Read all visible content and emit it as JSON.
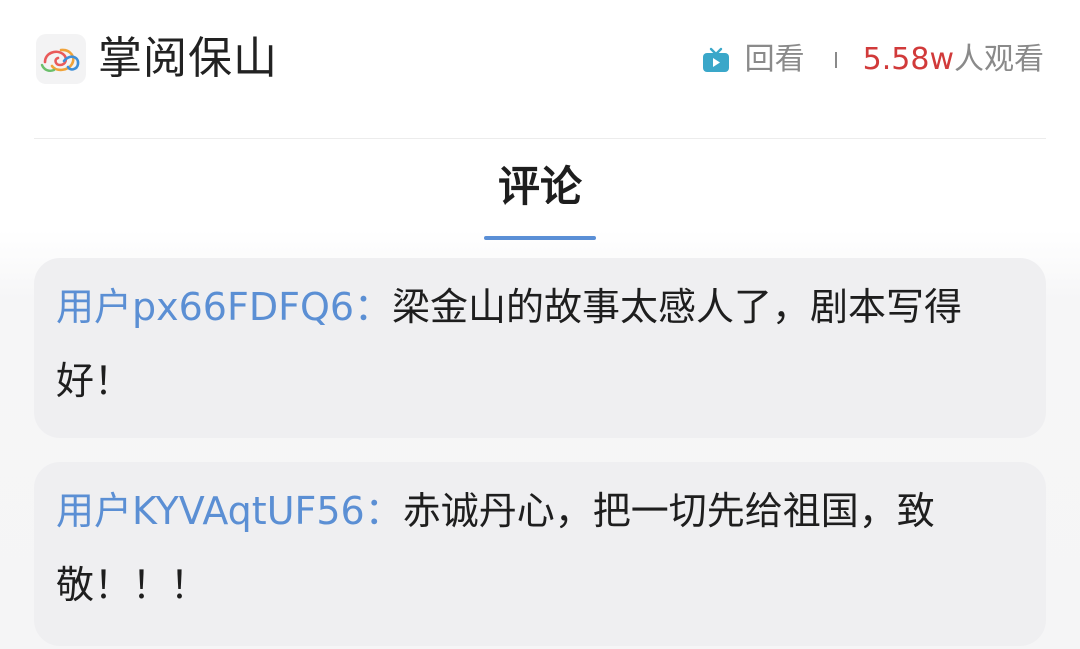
{
  "header": {
    "app_title": "掌阅保山",
    "replay_label": "回看",
    "views_count": "5.58w",
    "views_suffix": "人观看",
    "colors": {
      "title": "#222222",
      "meta": "#8a8a8a",
      "views_count": "#d13a3a",
      "tv_icon": "#3aa7c9"
    }
  },
  "tabs": {
    "active_label": "评论",
    "accent": "#5a8fd6"
  },
  "comments": [
    {
      "user": "用户px66FDFQ6：",
      "text": "梁金山的故事太感人了，剧本写得好！"
    },
    {
      "user": "用户KYVAqtUF56：",
      "text": "赤诚丹心，把一切先给祖国，致敬！！！"
    }
  ],
  "icons": {
    "logo": "app-logo-icon",
    "replay": "tv-replay-icon"
  }
}
